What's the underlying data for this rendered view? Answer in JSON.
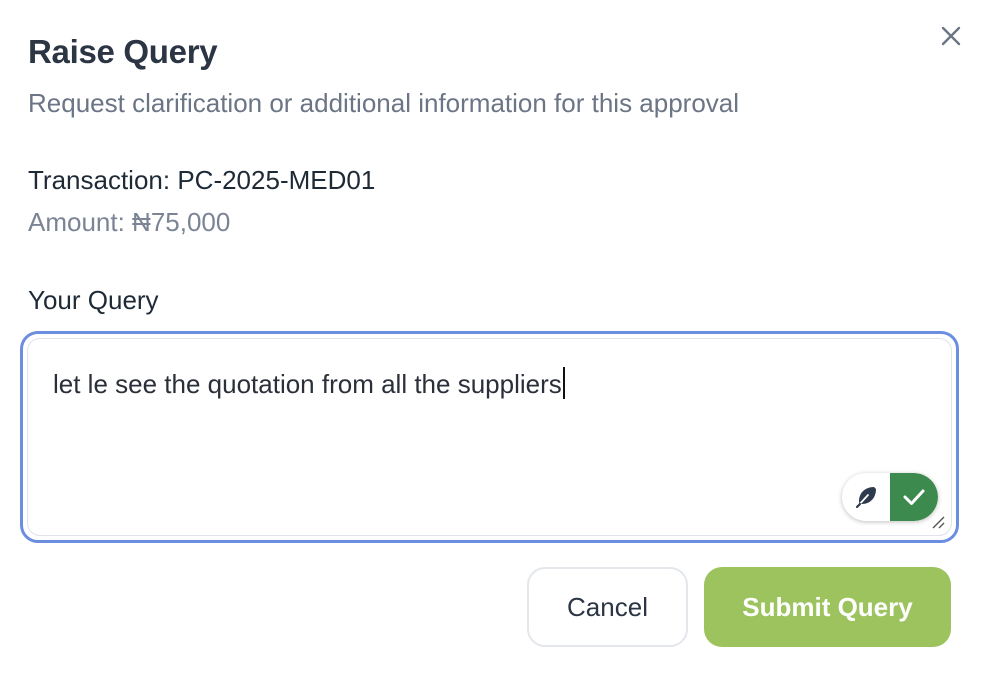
{
  "dialog": {
    "title": "Raise Query",
    "subtitle": "Request clarification or additional information for this approval",
    "close_icon": "close-icon"
  },
  "transaction": {
    "label": "Transaction: PC-2025-MED01",
    "amount": "Amount: ₦75,000"
  },
  "query": {
    "label": "Your Query",
    "value": "let le see the quotation from all the suppliers"
  },
  "grammar_widget": {
    "left_icon": "feather-icon",
    "right_icon": "check-icon",
    "accent": "#3d8a4f"
  },
  "actions": {
    "cancel_label": "Cancel",
    "submit_label": "Submit Query",
    "submit_color": "#9cc35e"
  },
  "colors": {
    "focus_border": "#6c8ee0",
    "title": "#2b3544",
    "muted": "#6b7585"
  }
}
